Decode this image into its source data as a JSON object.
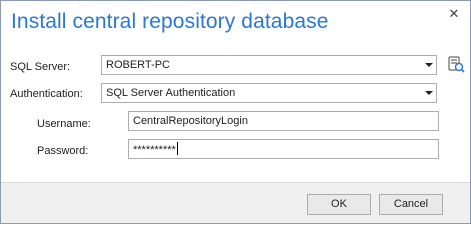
{
  "dialog": {
    "title": "Install central repository database",
    "close_glyph": "✕"
  },
  "form": {
    "sql_server_label": "SQL Server:",
    "sql_server_value": "ROBERT-PC",
    "authentication_label": "Authentication:",
    "authentication_value": "SQL Server Authentication",
    "username_label": "Username:",
    "username_value": "CentralRepositoryLogin",
    "password_label": "Password:",
    "password_value": "**********",
    "browse_icon": "server-browse-icon"
  },
  "footer": {
    "ok_label": "OK",
    "cancel_label": "Cancel"
  },
  "colors": {
    "title": "#2b78d4",
    "field_border": "#abadb3",
    "footer_bg": "#f0f0f0"
  }
}
